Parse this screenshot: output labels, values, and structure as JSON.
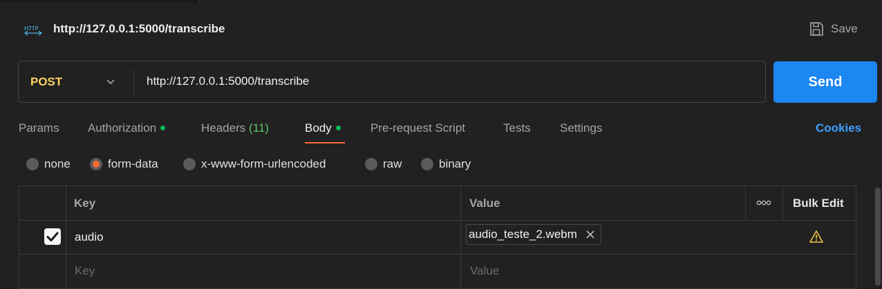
{
  "header": {
    "icon": "http-icon",
    "title": "http://127.0.0.1:5000/transcribe",
    "save_label": "Save"
  },
  "request": {
    "method": "POST",
    "url": "http://127.0.0.1:5000/transcribe",
    "send_label": "Send"
  },
  "tabs": [
    {
      "label": "Params"
    },
    {
      "label": "Authorization",
      "dot": true
    },
    {
      "label": "Headers",
      "count": "(11)"
    },
    {
      "label": "Body",
      "dot": true,
      "active": true
    },
    {
      "label": "Pre-request Script"
    },
    {
      "label": "Tests"
    },
    {
      "label": "Settings"
    }
  ],
  "cookies_label": "Cookies",
  "body_modes": [
    {
      "label": "none",
      "selected": false
    },
    {
      "label": "form-data",
      "selected": true
    },
    {
      "label": "x-www-form-urlencoded",
      "selected": false
    },
    {
      "label": "raw",
      "selected": false
    },
    {
      "label": "binary",
      "selected": false
    }
  ],
  "table": {
    "headers": {
      "key": "Key",
      "value": "Value",
      "bulk_edit": "Bulk Edit"
    },
    "rows": [
      {
        "checked": true,
        "key": "audio",
        "value_file": "audio_teste_2.webm",
        "warning": true
      }
    ],
    "placeholders": {
      "key": "Key",
      "value": "Value"
    }
  },
  "colors": {
    "accent": "#ff6c37",
    "send": "#1c86f2",
    "method": "#ffd561",
    "link": "#3da0ff",
    "dot": "#0cbb52",
    "warning": "#f2c94c"
  }
}
